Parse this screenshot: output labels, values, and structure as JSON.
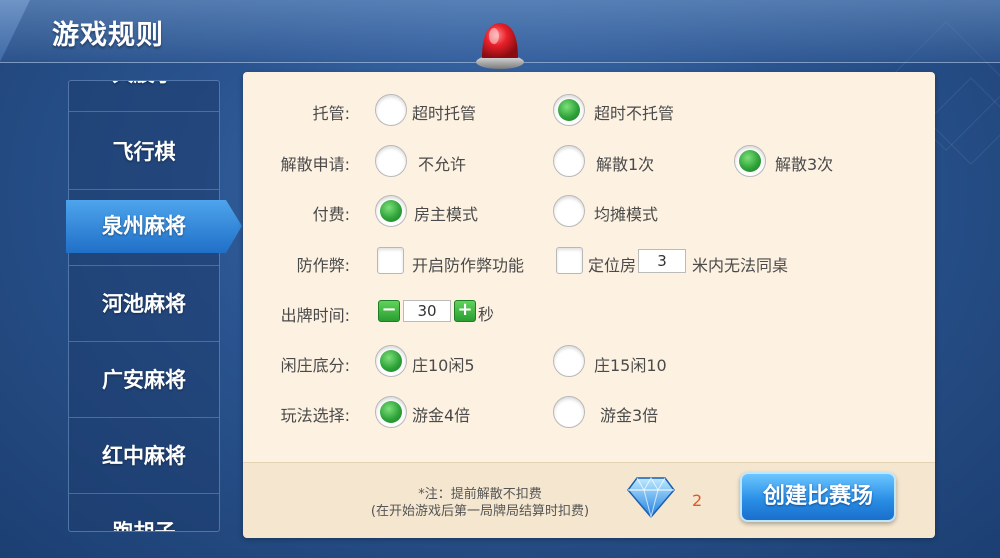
{
  "title": "游戏规则",
  "sidebar": {
    "items": [
      "大股子",
      "飞行棋",
      "泉州麻将",
      "河池麻将",
      "广安麻将",
      "红中麻将",
      "跑胡子"
    ],
    "active": "泉州麻将"
  },
  "rules": {
    "tuoguan": {
      "label": "托管:",
      "options": [
        "超时托管",
        "超时不托管"
      ],
      "selected": "超时不托管"
    },
    "dissolve": {
      "label": "解散申请:",
      "options": [
        "不允许",
        "解散1次",
        "解散3次"
      ],
      "selected": "解散3次"
    },
    "payment": {
      "label": "付费:",
      "options": [
        "房主模式",
        "均摊模式"
      ],
      "selected": "房主模式"
    },
    "anticheat": {
      "label": "防作弊:",
      "option1": "开启防作弊功能",
      "option2_prefix": "定位房",
      "distance_value": "3",
      "option2_suffix": "米内无法同桌"
    },
    "play_time": {
      "label": "出牌时间:",
      "value": "30",
      "unit": "秒",
      "minus": "−",
      "plus": "+"
    },
    "base_score": {
      "label": "闲庄底分:",
      "options": [
        "庄10闲5",
        "庄15闲10"
      ],
      "selected": "庄10闲5"
    },
    "play_mode": {
      "label": "玩法选择:",
      "options": [
        "游金4倍",
        "游金3倍"
      ],
      "selected": "游金4倍"
    }
  },
  "footer": {
    "note_line1": "*注：提前解散不扣费",
    "note_line2": "(在开始游戏后第一局牌局结算时扣费)",
    "cost": "2",
    "create_button": "创建比赛场"
  },
  "colors": {
    "accent_green": "#2fa33a",
    "panel": "#fdf2e2",
    "button_blue": "#2a8fe6",
    "cost_text": "#e0582a"
  }
}
